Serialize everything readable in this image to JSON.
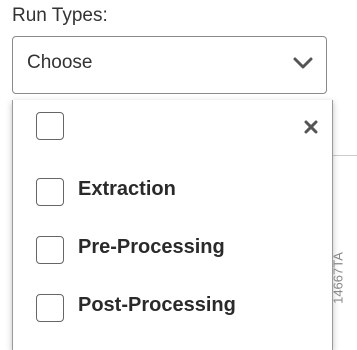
{
  "field": {
    "label": "Run Types:",
    "select_value": "Choose"
  },
  "dropdown": {
    "items": [
      {
        "label": "Extraction",
        "checked": false
      },
      {
        "label": "Pre-Processing",
        "checked": false
      },
      {
        "label": "Post-Processing",
        "checked": false
      }
    ]
  },
  "figure_id": "14667TA",
  "icons": {
    "select_arrow": "chevron-down-icon",
    "clear": "close-icon"
  },
  "colors": {
    "text": "#333333",
    "border": "#8a8a8a",
    "chevron": "#555555"
  }
}
